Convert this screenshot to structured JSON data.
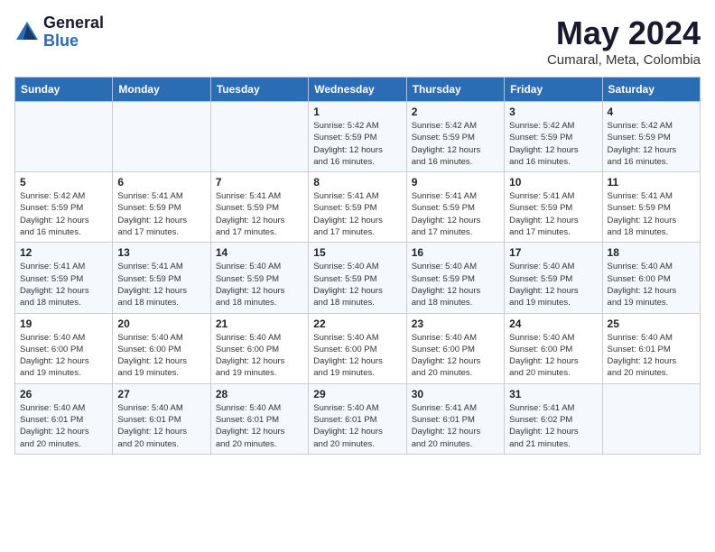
{
  "header": {
    "logo_general": "General",
    "logo_blue": "Blue",
    "month_title": "May 2024",
    "location": "Cumaral, Meta, Colombia"
  },
  "weekdays": [
    "Sunday",
    "Monday",
    "Tuesday",
    "Wednesday",
    "Thursday",
    "Friday",
    "Saturday"
  ],
  "weeks": [
    [
      {
        "day": "",
        "info": ""
      },
      {
        "day": "",
        "info": ""
      },
      {
        "day": "",
        "info": ""
      },
      {
        "day": "1",
        "info": "Sunrise: 5:42 AM\nSunset: 5:59 PM\nDaylight: 12 hours\nand 16 minutes."
      },
      {
        "day": "2",
        "info": "Sunrise: 5:42 AM\nSunset: 5:59 PM\nDaylight: 12 hours\nand 16 minutes."
      },
      {
        "day": "3",
        "info": "Sunrise: 5:42 AM\nSunset: 5:59 PM\nDaylight: 12 hours\nand 16 minutes."
      },
      {
        "day": "4",
        "info": "Sunrise: 5:42 AM\nSunset: 5:59 PM\nDaylight: 12 hours\nand 16 minutes."
      }
    ],
    [
      {
        "day": "5",
        "info": "Sunrise: 5:42 AM\nSunset: 5:59 PM\nDaylight: 12 hours\nand 16 minutes."
      },
      {
        "day": "6",
        "info": "Sunrise: 5:41 AM\nSunset: 5:59 PM\nDaylight: 12 hours\nand 17 minutes."
      },
      {
        "day": "7",
        "info": "Sunrise: 5:41 AM\nSunset: 5:59 PM\nDaylight: 12 hours\nand 17 minutes."
      },
      {
        "day": "8",
        "info": "Sunrise: 5:41 AM\nSunset: 5:59 PM\nDaylight: 12 hours\nand 17 minutes."
      },
      {
        "day": "9",
        "info": "Sunrise: 5:41 AM\nSunset: 5:59 PM\nDaylight: 12 hours\nand 17 minutes."
      },
      {
        "day": "10",
        "info": "Sunrise: 5:41 AM\nSunset: 5:59 PM\nDaylight: 12 hours\nand 17 minutes."
      },
      {
        "day": "11",
        "info": "Sunrise: 5:41 AM\nSunset: 5:59 PM\nDaylight: 12 hours\nand 18 minutes."
      }
    ],
    [
      {
        "day": "12",
        "info": "Sunrise: 5:41 AM\nSunset: 5:59 PM\nDaylight: 12 hours\nand 18 minutes."
      },
      {
        "day": "13",
        "info": "Sunrise: 5:41 AM\nSunset: 5:59 PM\nDaylight: 12 hours\nand 18 minutes."
      },
      {
        "day": "14",
        "info": "Sunrise: 5:40 AM\nSunset: 5:59 PM\nDaylight: 12 hours\nand 18 minutes."
      },
      {
        "day": "15",
        "info": "Sunrise: 5:40 AM\nSunset: 5:59 PM\nDaylight: 12 hours\nand 18 minutes."
      },
      {
        "day": "16",
        "info": "Sunrise: 5:40 AM\nSunset: 5:59 PM\nDaylight: 12 hours\nand 18 minutes."
      },
      {
        "day": "17",
        "info": "Sunrise: 5:40 AM\nSunset: 5:59 PM\nDaylight: 12 hours\nand 19 minutes."
      },
      {
        "day": "18",
        "info": "Sunrise: 5:40 AM\nSunset: 6:00 PM\nDaylight: 12 hours\nand 19 minutes."
      }
    ],
    [
      {
        "day": "19",
        "info": "Sunrise: 5:40 AM\nSunset: 6:00 PM\nDaylight: 12 hours\nand 19 minutes."
      },
      {
        "day": "20",
        "info": "Sunrise: 5:40 AM\nSunset: 6:00 PM\nDaylight: 12 hours\nand 19 minutes."
      },
      {
        "day": "21",
        "info": "Sunrise: 5:40 AM\nSunset: 6:00 PM\nDaylight: 12 hours\nand 19 minutes."
      },
      {
        "day": "22",
        "info": "Sunrise: 5:40 AM\nSunset: 6:00 PM\nDaylight: 12 hours\nand 19 minutes."
      },
      {
        "day": "23",
        "info": "Sunrise: 5:40 AM\nSunset: 6:00 PM\nDaylight: 12 hours\nand 20 minutes."
      },
      {
        "day": "24",
        "info": "Sunrise: 5:40 AM\nSunset: 6:00 PM\nDaylight: 12 hours\nand 20 minutes."
      },
      {
        "day": "25",
        "info": "Sunrise: 5:40 AM\nSunset: 6:01 PM\nDaylight: 12 hours\nand 20 minutes."
      }
    ],
    [
      {
        "day": "26",
        "info": "Sunrise: 5:40 AM\nSunset: 6:01 PM\nDaylight: 12 hours\nand 20 minutes."
      },
      {
        "day": "27",
        "info": "Sunrise: 5:40 AM\nSunset: 6:01 PM\nDaylight: 12 hours\nand 20 minutes."
      },
      {
        "day": "28",
        "info": "Sunrise: 5:40 AM\nSunset: 6:01 PM\nDaylight: 12 hours\nand 20 minutes."
      },
      {
        "day": "29",
        "info": "Sunrise: 5:40 AM\nSunset: 6:01 PM\nDaylight: 12 hours\nand 20 minutes."
      },
      {
        "day": "30",
        "info": "Sunrise: 5:41 AM\nSunset: 6:01 PM\nDaylight: 12 hours\nand 20 minutes."
      },
      {
        "day": "31",
        "info": "Sunrise: 5:41 AM\nSunset: 6:02 PM\nDaylight: 12 hours\nand 21 minutes."
      },
      {
        "day": "",
        "info": ""
      }
    ]
  ]
}
